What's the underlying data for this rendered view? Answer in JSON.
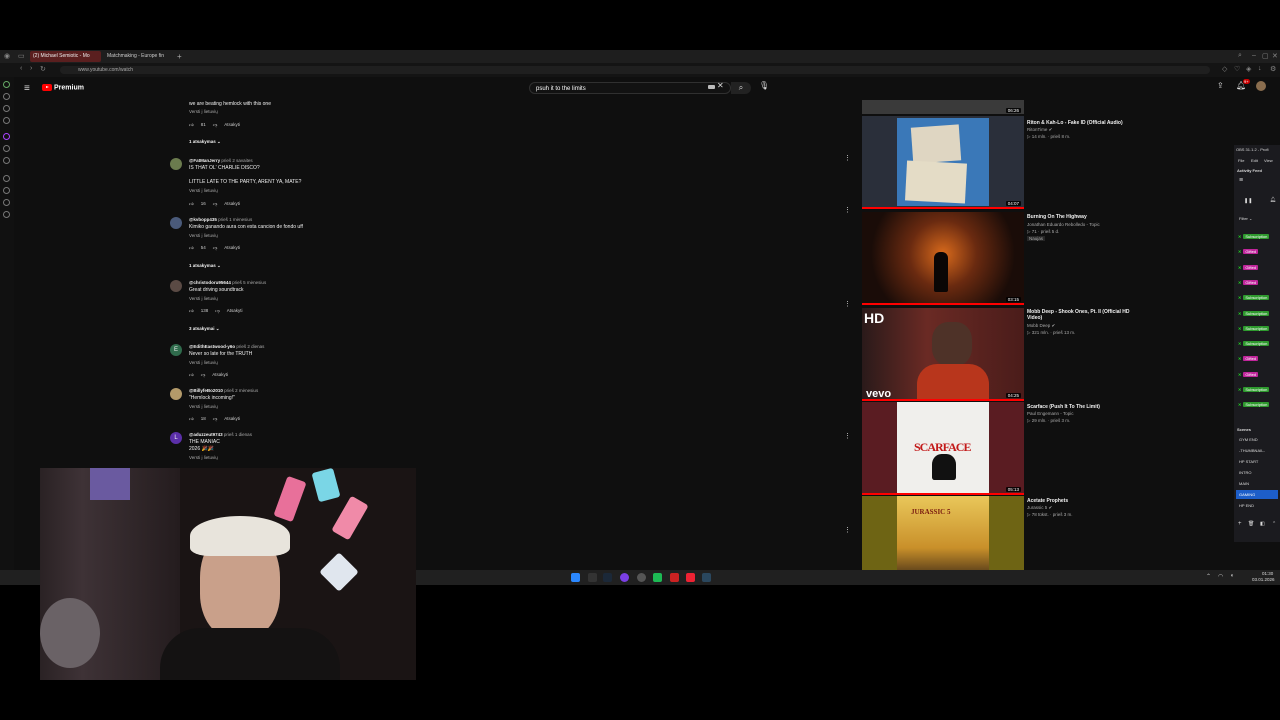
{
  "browser": {
    "tabs": [
      {
        "label": "(2) Michael Semiotic - Mo"
      },
      {
        "label": "Matchmaking - Europe fin"
      }
    ],
    "new_tab": "+",
    "url": "www.youtube.com/watch"
  },
  "youtube": {
    "logo": "Premium",
    "search": {
      "value": "psuh it to the limits"
    },
    "notification_count": "9+"
  },
  "comments": [
    {
      "author": "",
      "time": "",
      "text": "we are beating hemlock with this one",
      "translate": "Versti į lietuvių",
      "likes": "81",
      "reply": "Atsakyti",
      "replies": "1 atsakymas"
    },
    {
      "author": "@FatManJerry",
      "time": "prieš 2 savaites",
      "text": "IS THAT OL' CHARLIE DISCO?\n\nLITTLE LATE TO THE PARTY, ARENT YA, MATE?",
      "translate": "Versti į lietuvių",
      "likes": "16",
      "reply": "Atsakyti",
      "replies": ""
    },
    {
      "author": "@kvbopp435",
      "time": "prieš 1 mėnesius",
      "text": "Kimiko ganando aura con esta cancion de fondo uff",
      "translate": "Versti į lietuvių",
      "likes": "54",
      "reply": "Atsakyti",
      "replies": "1 atsakymas"
    },
    {
      "author": "@christodoru95644",
      "time": "prieš 5 mėnesius",
      "text": "Great driving soundtrack",
      "translate": "Versti į lietuvių",
      "likes": "138",
      "reply": "Atsakyti",
      "replies": "3 atsakymai"
    },
    {
      "author": "@EdithEastwood-y6o",
      "time": "prieš 2 dienas",
      "text": "Never so late for the TRUTH",
      "translate": "Versti į lietuvių",
      "likes": "",
      "reply": "Atsakyti",
      "replies": ""
    },
    {
      "author": "@BillyfeBo2010",
      "time": "prieš 2 mėnesius",
      "text": "\"Hemlock incoming!\"",
      "translate": "Versti į lietuvių",
      "likes": "18",
      "reply": "Atsakyti",
      "replies": ""
    },
    {
      "author": "@aduzzeut9743",
      "time": "prieš 1 dienas",
      "text": "THE MANIAC\n2026 🎉🎉",
      "translate": "Versti į lietuvių",
      "likes": "",
      "reply": "",
      "replies": ""
    }
  ],
  "videos": [
    {
      "title": "",
      "channel": "",
      "meta": "",
      "duration": "06:26"
    },
    {
      "title": "Riton & Kah-Lo - Fake ID (Official Audio)",
      "channel": "RitonTime ✔",
      "meta": "▷ 14 mln. · prieš 8 m.",
      "duration": "04:07",
      "thumb_text": ""
    },
    {
      "title": "Burning On The Highway",
      "channel": "Jonathan Eduardo Rebolledo - Topic",
      "meta": "▷ 71 · prieš 5 d.",
      "badge": "Naujas",
      "duration": "03:15"
    },
    {
      "title": "Mobb Deep - Shook Ones, Pt. II (Official HD Video)",
      "channel": "Mobb Deep ✔",
      "meta": "▷ 321 mln. · prieš 13 m.",
      "duration": "04:25",
      "thumb_hd": "HD",
      "thumb_brand": "vevo"
    },
    {
      "title": "Scarface (Push It To The Limit)",
      "channel": "Paul Engemann - Topic",
      "meta": "▷ 29 mln. · prieš 3 m.",
      "duration": "05:13",
      "thumb_text": "SCARFACE"
    },
    {
      "title": "Acetate Prophets",
      "channel": "Jurassic 5 ✔",
      "meta": "▷ 78 tūkst. · prieš 3 m.",
      "duration": "",
      "thumb_text": "JURASSIC 5"
    }
  ],
  "obs": {
    "title": "OBS 31.1.2 - Profi",
    "menu": [
      "File",
      "Edit",
      "View"
    ],
    "panel": "Activity Feed",
    "filter": "Filter",
    "feed": [
      {
        "type": "sub",
        "label": "Subscription"
      },
      {
        "type": "gift",
        "label": "Gifted"
      },
      {
        "type": "gift",
        "label": "Gifted"
      },
      {
        "type": "gift",
        "label": "Gifted"
      },
      {
        "type": "sub",
        "label": "Subscription"
      },
      {
        "type": "sub",
        "label": "Subscription"
      },
      {
        "type": "sub",
        "label": "Subscription"
      },
      {
        "type": "sub",
        "label": "Subscription"
      },
      {
        "type": "gift",
        "label": "Gifted"
      },
      {
        "type": "gift",
        "label": "Gifted"
      },
      {
        "type": "sub",
        "label": "Subscription"
      },
      {
        "type": "sub",
        "label": "Subscription"
      }
    ],
    "scenes_label": "Scenes",
    "scenes": [
      "GYM END",
      "-THUMBNAIL-",
      "HP START",
      "INTRO",
      "MAIN",
      "GAMING",
      "HP END"
    ],
    "selected_scene": "GAMING"
  },
  "taskbar": {
    "time": "01:30",
    "date": "03.01.2026"
  },
  "colors": {
    "yt_bg": "#0f0f0f",
    "red": "#ff0000",
    "sub": "#2e9a2e",
    "gift": "#c0259b",
    "scene_sel": "#1d5ec9"
  }
}
